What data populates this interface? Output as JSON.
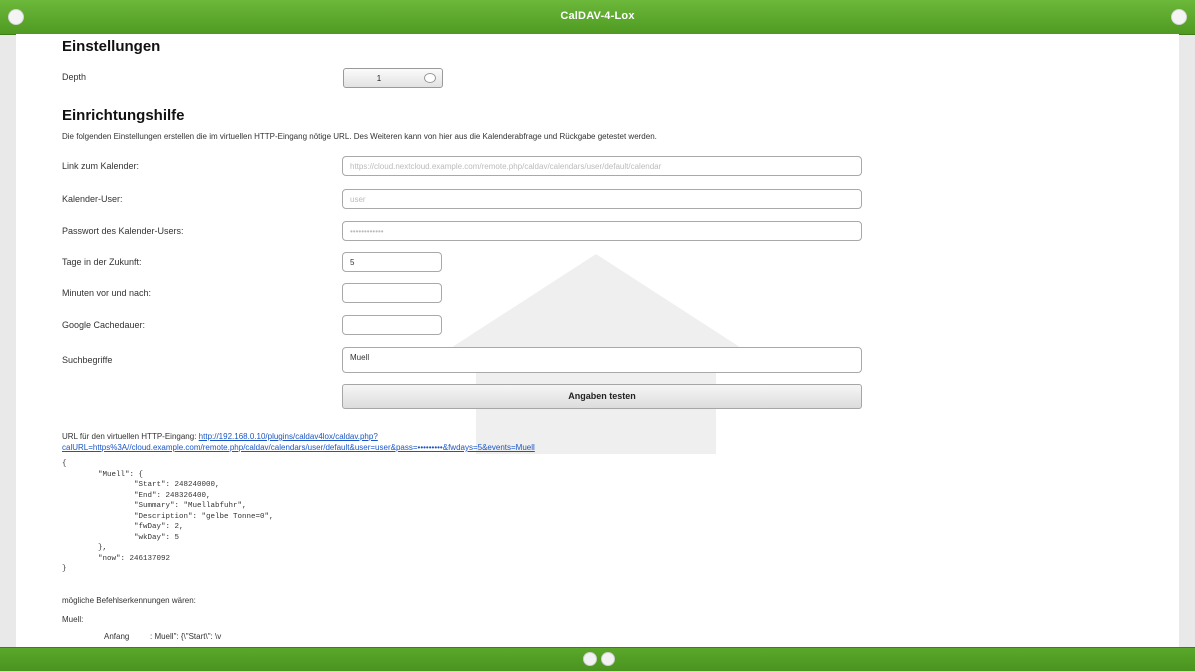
{
  "app": {
    "title": "CalDAV-4-Lox"
  },
  "settings": {
    "heading": "Einstellungen",
    "depth_label": "Depth",
    "depth_value": "1"
  },
  "setup": {
    "heading": "Einrichtungshilfe",
    "description": "Die folgenden Einstellungen erstellen die im virtuellen HTTP-Eingang nötige URL. Des Weiteren kann von hier aus die Kalenderabfrage und Rückgabe getestet werden.",
    "fields": {
      "calendar_link": {
        "label": "Link zum Kalender:",
        "value": "https://cloud.nextcloud.example.com/remote.php/caldav/calendars/user/default/calendar"
      },
      "calendar_user": {
        "label": "Kalender-User:",
        "value": "user"
      },
      "calendar_password": {
        "label": "Passwort des Kalender-Users:",
        "value": "••••••••••••"
      },
      "days_ahead": {
        "label": "Tage in der Zukunft:",
        "value": "5"
      },
      "minutes_before_after": {
        "label": "Minuten vor und nach:",
        "value": ""
      },
      "google_cache": {
        "label": "Google Cachedauer:",
        "value": ""
      },
      "search_terms": {
        "label": "Suchbegriffe",
        "value": "Muell"
      }
    },
    "test_button": "Angaben testen"
  },
  "result": {
    "url_label": "URL für den virtuellen HTTP-Eingang:",
    "url_line1": "http://192.168.0.10/plugins/caldav4lox/caldav.php?",
    "url_line2": "calURL=https%3A//cloud.example.com/remote.php/caldav/calendars/user/default&user=user&pass=•••••••••&fwdays=5&events=Muell",
    "json_output": "{\n        \"Muell\": {\n                \"Start\": 248240000,\n                \"End\": 248326400,\n                \"Summary\": \"Muellabfuhr\",\n                \"Description\": \"gelbe Tonne=0\",\n                \"fwDay\": 2,\n                \"wkDay\": 5\n        },\n        \"now\": 246137092\n}",
    "commands_label": "mögliche Befehlserkennungen wären:",
    "event_name": "Muell:",
    "row1_key": "Anfang",
    "row1_val": ": Muell\": {\\\"Start\\\": \\v"
  }
}
